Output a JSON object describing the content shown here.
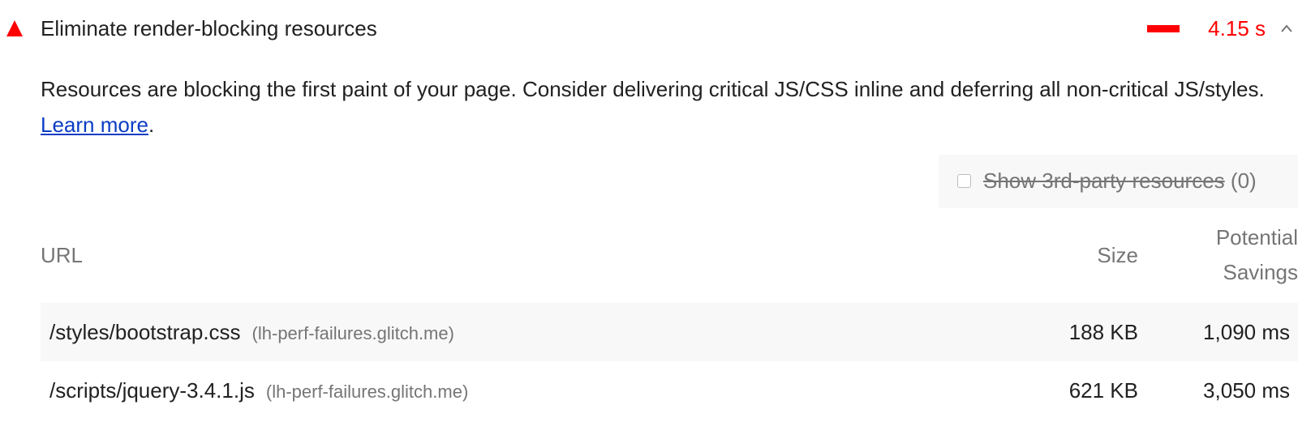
{
  "audit": {
    "title": "Eliminate render-blocking resources",
    "display_value": "4.15 s",
    "status_color": "#ff0000",
    "status_icon": "fail-triangle-icon",
    "expanded": true,
    "toggle_icon": "chevron-up-icon"
  },
  "description": {
    "text": "Resources are blocking the first paint of your page. Consider delivering critical JS/CSS inline and deferring all non-critical JS/styles.",
    "link_label": "Learn more",
    "trailing": "."
  },
  "filter": {
    "label": "Show 3rd-party resources",
    "count": "(0)",
    "checked": false
  },
  "table": {
    "columns": {
      "url": "URL",
      "size": "Size",
      "savings_line1": "Potential",
      "savings_line2": "Savings"
    },
    "rows": [
      {
        "url": "/styles/bootstrap.css",
        "host": "(lh-perf-failures.glitch.me)",
        "size": "188 KB",
        "savings": "1,090 ms"
      },
      {
        "url": "/scripts/jquery-3.4.1.js",
        "host": "(lh-perf-failures.glitch.me)",
        "size": "621 KB",
        "savings": "3,050 ms"
      }
    ]
  },
  "colors": {
    "fail": "#ff0000",
    "link": "#0b3cc4",
    "muted_text": "#757575",
    "row_stripe": "#f8f8f8"
  }
}
